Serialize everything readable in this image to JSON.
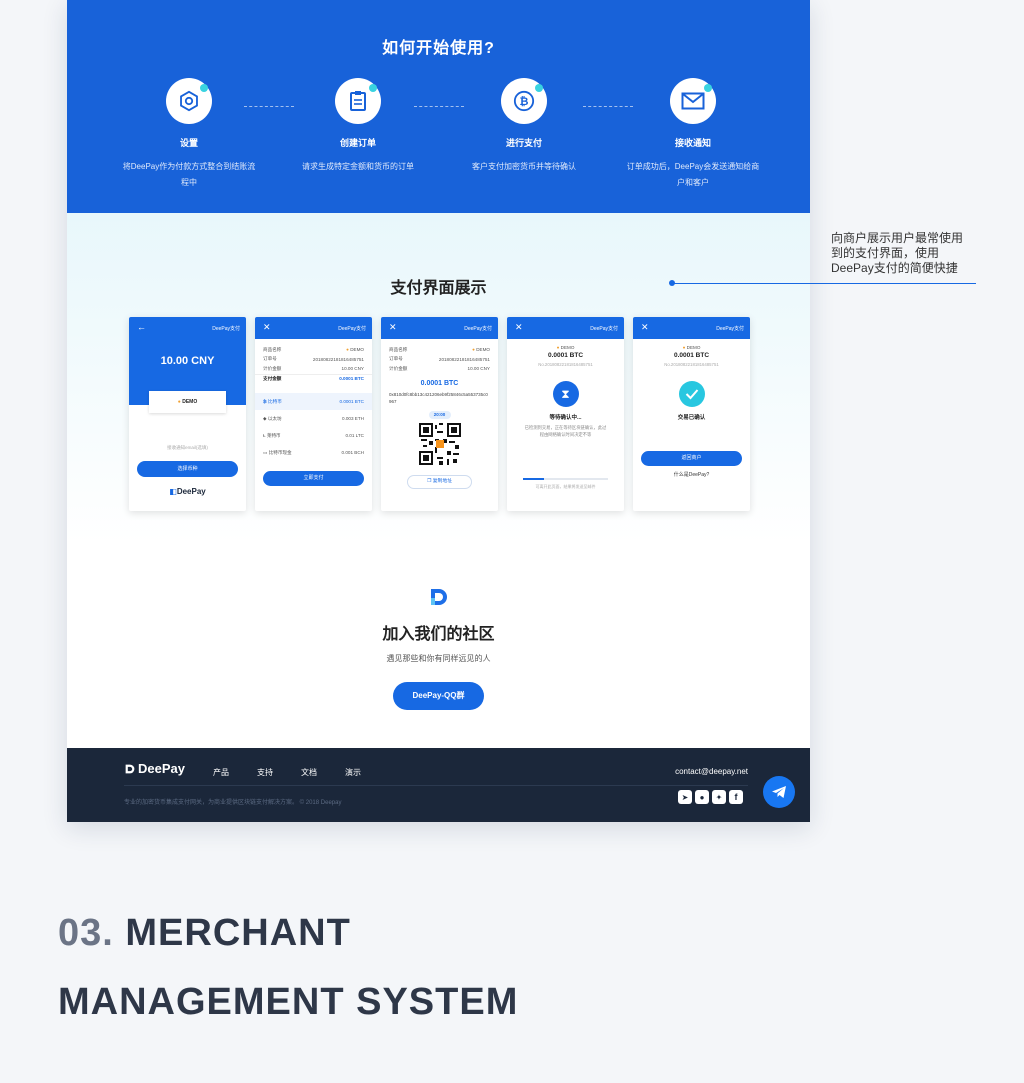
{
  "how_to": {
    "title": "如何开始使用?",
    "steps": [
      {
        "icon": "gear-icon",
        "title": "设置",
        "desc": "将DeePay作为付款方式整合到结账流程中"
      },
      {
        "icon": "order-document-icon",
        "title": "创建订单",
        "desc": "请求生成特定金额和货币的订单"
      },
      {
        "icon": "bitcoin-icon",
        "title": "进行支付",
        "desc": "客户支付加密货币并等待确认"
      },
      {
        "icon": "envelope-icon",
        "title": "接收通知",
        "desc": "订单成功后，DeePay会发送通知给商户和客户"
      }
    ]
  },
  "callout": {
    "line1": "向商户展示用户最常使用",
    "line2": "到的支付界面，使用",
    "line3": "DeePay支付的简便快捷"
  },
  "showcase": {
    "title": "支付界面展示",
    "brand_small": "DeePay支付",
    "phone1": {
      "amount": "10.00 CNY",
      "merchant": "DEMO",
      "hint": "接收通知email(选填)",
      "button": "选择币种",
      "logo": "DeePay"
    },
    "phone2": {
      "rows": [
        {
          "k": "商品名称",
          "v": "DEMO"
        },
        {
          "k": "订单号",
          "v": "20180822181816485751"
        },
        {
          "k": "计价金额",
          "v": "10.00 CNY"
        },
        {
          "k": "支付金额",
          "v": "0.0001 BTC"
        }
      ],
      "coins": [
        {
          "icon": "bitcoin-coin-icon",
          "name": "比特币",
          "amt": "0.0001 BTC"
        },
        {
          "icon": "ethereum-coin-icon",
          "name": "以太坊",
          "amt": "0.003 ETH"
        },
        {
          "icon": "litecoin-coin-icon",
          "name": "莱特币",
          "amt": "0.01 LTC"
        },
        {
          "icon": "bitcoin-cash-coin-icon",
          "name": "比特币现金",
          "amt": "0.001 BCH"
        }
      ],
      "button": "立即支付"
    },
    "phone3": {
      "rows": [
        {
          "k": "商品名称",
          "v": "DEMO"
        },
        {
          "k": "订单号",
          "v": "20180822181816485751"
        },
        {
          "k": "计价金额",
          "v": "10.00 CNY"
        }
      ],
      "amount": "0.0001 BTC",
      "address": "0x810d0fc8bb13c421206eb9f25846c5a553735c0967",
      "timer": "20:00",
      "copy": "复制地址"
    },
    "phone4": {
      "merchant": "DEMO",
      "amount": "0.0001 BTC",
      "order": "No.20180822181816485751",
      "status": "等待确认中...",
      "note": "已检测到交易，正在等待区块链确认，此过程由网络确认时间决定不等",
      "footer": "可离开此页面，结果将发送至邮件",
      "progress": 0.25
    },
    "phone5": {
      "merchant": "DEMO",
      "amount": "0.0001 BTC",
      "order": "No.20180822181816485751",
      "status": "交易已确认",
      "button": "返回商户",
      "link": "什么是DeePay?"
    }
  },
  "community": {
    "title": "加入我们的社区",
    "subtitle": "遇见那些和你有同样远见的人",
    "button": "DeePay-QQ群"
  },
  "footer": {
    "logo": "DeePay",
    "nav": [
      "产品",
      "支持",
      "文档",
      "演示"
    ],
    "email": "contact@deepay.net",
    "copyright": "专业的加密货币集成支付网关，为商业提供区块链支付解决方案。 © 2018 Deepay",
    "social": [
      "telegram-icon",
      "qq-icon",
      "twitter-icon",
      "facebook-icon"
    ]
  },
  "section": {
    "number": "03.",
    "line1": "MERCHANT",
    "line2": "MANAGEMENT SYSTEM"
  },
  "colors": {
    "primary": "#1862d9",
    "footer": "#1b273a",
    "accent": "#39d3e0",
    "success": "#28c7e0"
  }
}
